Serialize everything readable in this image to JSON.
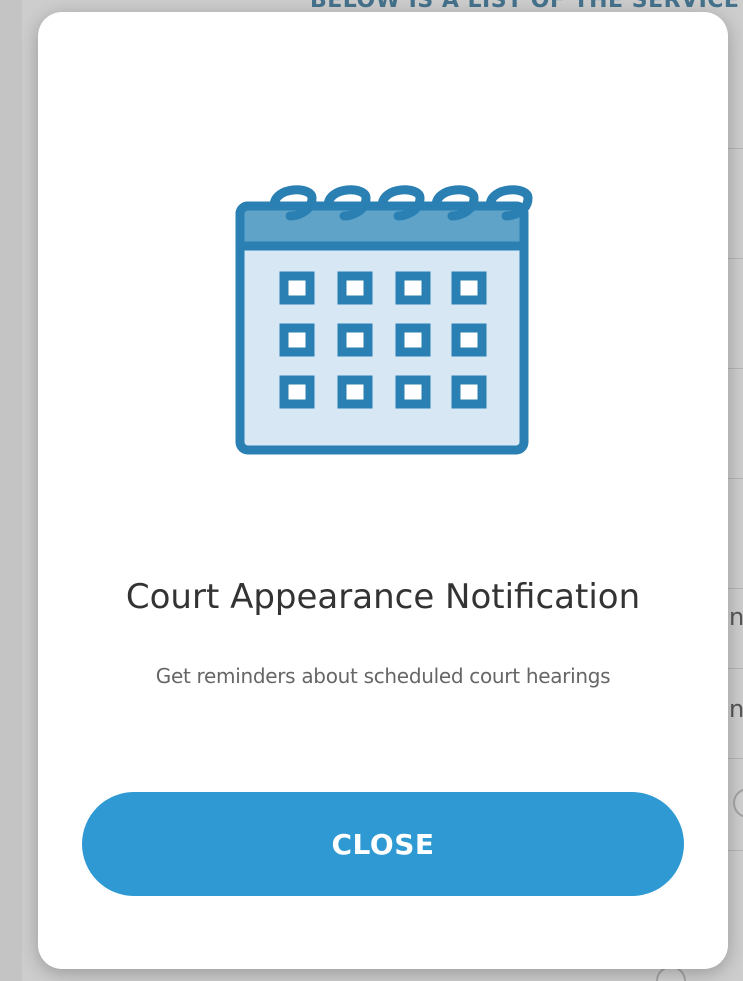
{
  "background": {
    "heading": "BELOW IS A LIST OF THE SERVICE",
    "fragments": [
      "n",
      "n"
    ]
  },
  "modal": {
    "icon": "calendar-icon",
    "title": "Court Appearance Notification",
    "subtitle": "Get reminders about scheduled court hearings",
    "close_label": "CLOSE",
    "colors": {
      "accent": "#2f99d3",
      "icon_stroke": "#2a7fb3",
      "icon_header": "#5fa3c9",
      "icon_body": "#d7e8f4"
    }
  }
}
